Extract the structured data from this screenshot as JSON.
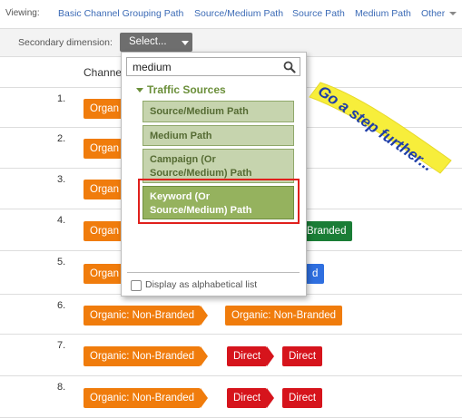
{
  "viewing": {
    "label": "Viewing:",
    "links": [
      "Basic Channel Grouping Path",
      "Source/Medium Path",
      "Source Path",
      "Medium Path",
      "Other"
    ]
  },
  "secondary": {
    "label": "Secondary dimension:",
    "select_label": "Select..."
  },
  "table": {
    "column_header": "Channe",
    "rows": [
      {
        "num": "1.",
        "chips": [
          {
            "text": "Organ",
            "color": "orange"
          }
        ]
      },
      {
        "num": "2.",
        "chips": [
          {
            "text": "Organ",
            "color": "orange"
          }
        ]
      },
      {
        "num": "3.",
        "chips": [
          {
            "text": "Organ",
            "color": "orange"
          }
        ]
      },
      {
        "num": "4.",
        "chips": [
          {
            "text": "Organ",
            "color": "orange"
          },
          {
            "text": "Branded",
            "color": "green"
          }
        ]
      },
      {
        "num": "5.",
        "chips": [
          {
            "text": "Organ",
            "color": "orange"
          },
          {
            "text": "d",
            "color": "blue"
          }
        ]
      },
      {
        "num": "6.",
        "chips": [
          {
            "text": "Organic: Non-Branded",
            "color": "orange"
          },
          {
            "text": "Organic: Non-Branded",
            "color": "orange"
          }
        ]
      },
      {
        "num": "7.",
        "chips": [
          {
            "text": "Organic: Non-Branded",
            "color": "orange"
          },
          {
            "text": "Direct",
            "color": "red"
          },
          {
            "text": "Direct",
            "color": "red"
          }
        ]
      },
      {
        "num": "8.",
        "chips": [
          {
            "text": "Organic: Non-Branded",
            "color": "orange"
          },
          {
            "text": "Direct",
            "color": "red"
          },
          {
            "text": "Direct",
            "color": "red"
          }
        ]
      }
    ]
  },
  "dropdown": {
    "search_value": "medium",
    "category": "Traffic Sources",
    "options": [
      {
        "lines": [
          "Source/Medium Path"
        ]
      },
      {
        "lines": [
          "Medium Path"
        ]
      },
      {
        "lines": [
          "Campaign (Or",
          "Source/Medium) Path"
        ]
      },
      {
        "lines": [
          "Keyword (Or",
          "Source/Medium) Path"
        ]
      }
    ],
    "alpha_label": "Display as alphabetical list"
  },
  "banner": {
    "text": "Go a step further...",
    "fill_color": "#f7ee3b",
    "text_color": "#1f3ea8"
  },
  "colors": {
    "orange": "#f07c0c",
    "red": "#d6141c",
    "green": "#1a7d36",
    "blue": "#2f6fe0",
    "highlight": "#e0201c"
  }
}
